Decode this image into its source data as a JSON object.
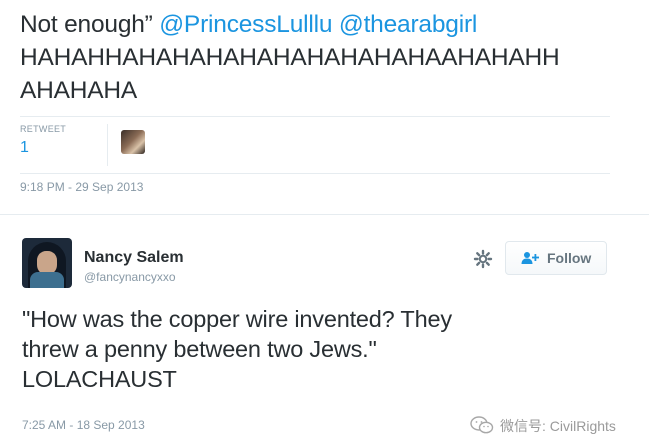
{
  "tweet1": {
    "text_segments": {
      "s1": "Not enough” ",
      "s2": "@PrincessLulllu",
      "s3": " ",
      "s4": "@thearabgirl",
      "s5": "HAHAHHAHAHAHAHAHAHAHAHAHAAHAHAHH",
      "s6": "AHAHAHA"
    },
    "retweet_label": "RETWEET",
    "retweet_count": "1",
    "timestamp": "9:18 PM - 29 Sep 2013"
  },
  "tweet2": {
    "user_name": "Nancy Salem",
    "handle": "@fancynancyxxo",
    "follow_label": "Follow",
    "text_lines": [
      "\"How was the copper wire invented? They",
      "threw a penny between two Jews.\"",
      "LOLACHAUST"
    ],
    "timestamp": "7:25 AM - 18 Sep 2013"
  },
  "watermark": {
    "text": "微信号: CivilRights"
  },
  "icons": {
    "gear": "gear-icon",
    "follow": "add-user-icon",
    "watermark": "wechat-icon"
  },
  "colors": {
    "mention": "#1b95e0",
    "text": "#292f33",
    "muted": "#8899a6",
    "border": "#e6ecf0"
  }
}
